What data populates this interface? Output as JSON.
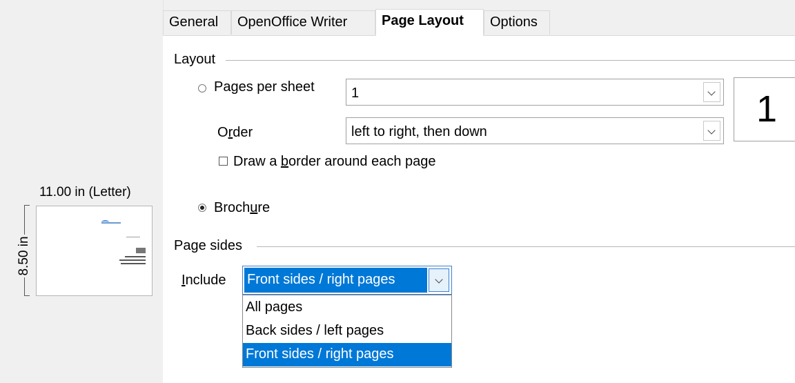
{
  "tabs": [
    {
      "label": "General",
      "active": false
    },
    {
      "label": "OpenOffice Writer",
      "active": false
    },
    {
      "label": "Page Layout",
      "active": true
    },
    {
      "label": "Options",
      "active": false
    }
  ],
  "preview": {
    "width_label": "11.00 in (Letter)",
    "height_label": "8.50 in"
  },
  "layout": {
    "title": "Layout",
    "pages_per_sheet": {
      "label_pre": "Pa",
      "label_u": "g",
      "label_post": "es per sheet",
      "value": "1",
      "selected": false
    },
    "order": {
      "label_pre": "O",
      "label_u": "r",
      "label_post": "der",
      "value": "left to right, then down"
    },
    "draw_border": {
      "label_pre": "Draw a ",
      "label_u": "b",
      "label_post": "order around each page",
      "checked": false
    },
    "big_number": "1",
    "brochure": {
      "label_pre": "Broch",
      "label_u": "u",
      "label_post": "re",
      "selected": true
    }
  },
  "page_sides": {
    "title": "Page sides",
    "include": {
      "label_u": "I",
      "label_post": "nclude",
      "value": "Front sides / right pages",
      "options": [
        "All pages",
        "Back sides / left pages",
        "Front sides / right pages"
      ],
      "selected_index": 2
    }
  },
  "colors": {
    "accent": "#0078d7",
    "accent_border": "#3c7fd0",
    "panel_bg": "#f0f0f0"
  }
}
